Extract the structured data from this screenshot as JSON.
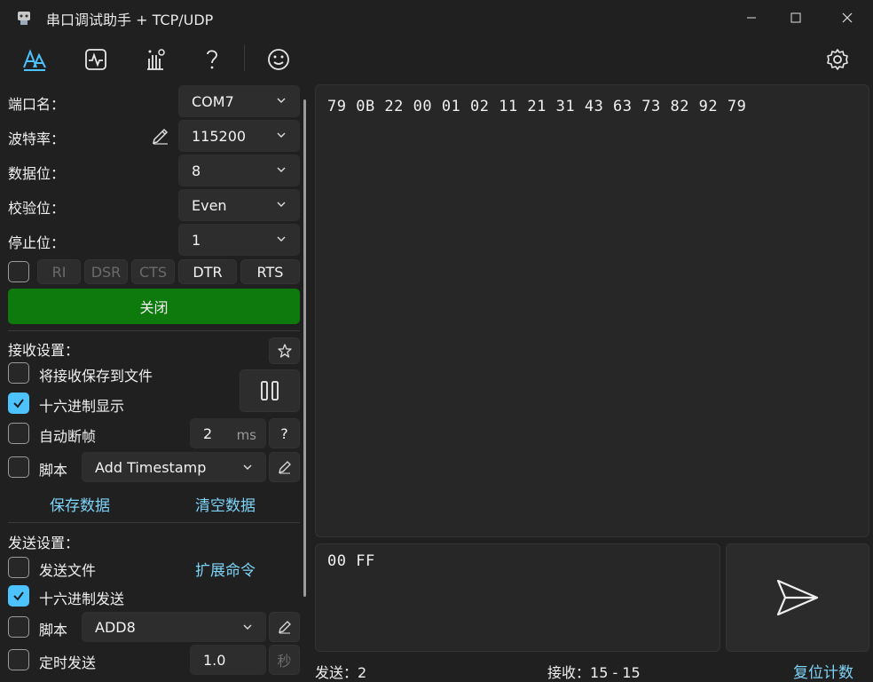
{
  "window": {
    "title": "串口调试助手 + TCP/UDP",
    "minimize": "—",
    "maximize": "☐",
    "close": "✕"
  },
  "toolbar": {
    "icons": [
      "font-icon",
      "pulse-icon",
      "hand-icon",
      "help-icon",
      "smiley-icon",
      "gear-icon"
    ]
  },
  "port": {
    "name_label": "端口名：",
    "name_value": "COM7",
    "baud_label": "波特率：",
    "baud_value": "115200",
    "databits_label": "数据位：",
    "databits_value": "8",
    "parity_label": "校验位：",
    "parity_value": "Even",
    "stopbits_label": "停止位：",
    "stopbits_value": "1",
    "signals": [
      "RI",
      "DSR",
      "CTS",
      "DTR",
      "RTS"
    ],
    "open_close_label": "关闭"
  },
  "receive": {
    "heading": "接收设置：",
    "save_to_file": "将接收保存到文件",
    "hex_display": "十六进制显示",
    "auto_frame": "自动断帧",
    "frame_ms_value": "2",
    "frame_ms_unit": "ms",
    "frame_help": "?",
    "script_label": "脚本",
    "script_value": "Add Timestamp",
    "save_data": "保存数据",
    "clear_data": "清空数据"
  },
  "send": {
    "heading": "发送设置：",
    "send_file": "发送文件",
    "extend_cmd": "扩展命令",
    "hex_send": "十六进制发送",
    "script_label": "脚本",
    "script_value": "ADD8",
    "timed_send": "定时发送",
    "timed_value": "1.0",
    "timed_unit": "秒"
  },
  "receive_area": {
    "content": "79 0B 22 00 01 02 11 21 31 43 63 73 82 92 79"
  },
  "send_area": {
    "content": "00 FF"
  },
  "status": {
    "sent_label": "发送：",
    "sent_value": "2",
    "recv_label": "接收：",
    "recv_value": "15 - 15",
    "reset_label": "复位计数"
  },
  "colors": {
    "accent": "#4cc2ff",
    "open_button": "#0e7a0d",
    "link": "#7dd3f7"
  }
}
